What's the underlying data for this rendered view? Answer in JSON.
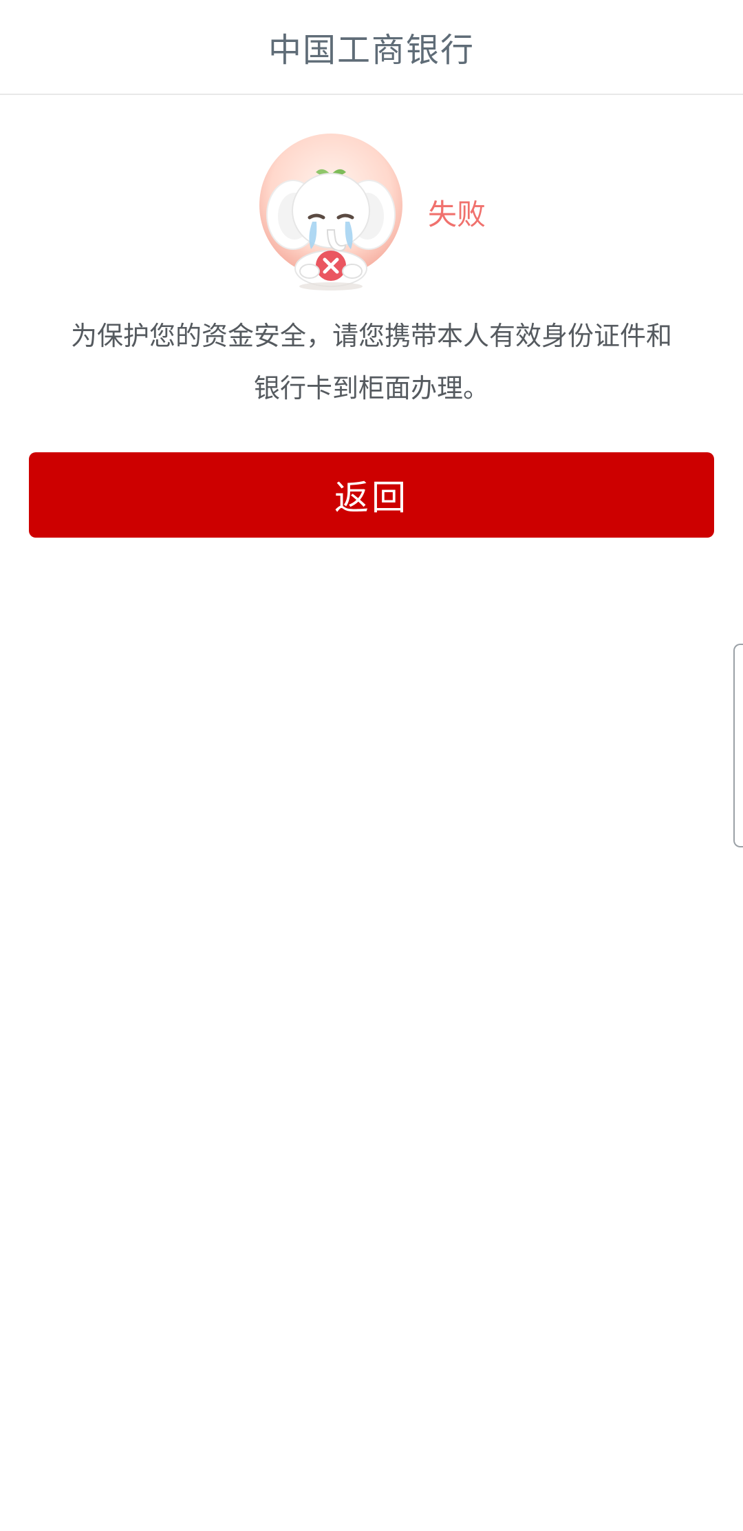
{
  "header": {
    "title": "中国工商银行"
  },
  "status": {
    "label": "失败",
    "icon": "crying-elephant-mascot-icon",
    "color": "#f0716d"
  },
  "message": {
    "text": "为保护您的资金安全，请您携带本人有效身份证件和银行卡到柜面办理。"
  },
  "actions": {
    "back_label": "返回",
    "back_color": "#cd0000"
  }
}
